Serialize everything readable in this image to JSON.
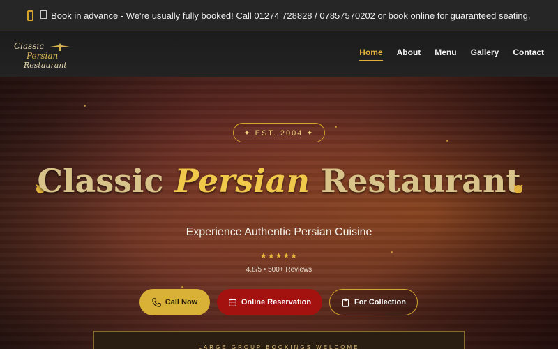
{
  "announcement": {
    "text": "Book in advance - We're usually fully booked! Call 01274 728828 / 07857570202 or book online for guaranteed seating."
  },
  "logo": {
    "line1": "Classic",
    "line2": "Persian",
    "line3": "Restaurant"
  },
  "nav": {
    "items": [
      {
        "label": "Home",
        "active": true
      },
      {
        "label": "About",
        "active": false
      },
      {
        "label": "Menu",
        "active": false
      },
      {
        "label": "Gallery",
        "active": false
      },
      {
        "label": "Contact",
        "active": false
      }
    ]
  },
  "hero": {
    "badge": "✦ EST. 2004 ✦",
    "title_part1": "Classic",
    "title_part2": "Persian",
    "title_part3": "Restaurant",
    "subtitle": "Experience Authentic Persian Cuisine",
    "stars": "★★★★★",
    "rating": "4.8/5 • 500+ Reviews",
    "buttons": {
      "call": "Call Now",
      "reserve": "Online Reservation",
      "collect": "For Collection"
    },
    "group_banner": "LARGE GROUP BOOKINGS WELCOME"
  },
  "colors": {
    "accent_gold": "#d8b136",
    "reserve_red": "#a3120f",
    "topbar_bg": "#262626"
  },
  "icons": [
    "phone-icon",
    "calendar-icon",
    "clipboard-icon",
    "persian-emblem-icon",
    "ornament-icon"
  ]
}
